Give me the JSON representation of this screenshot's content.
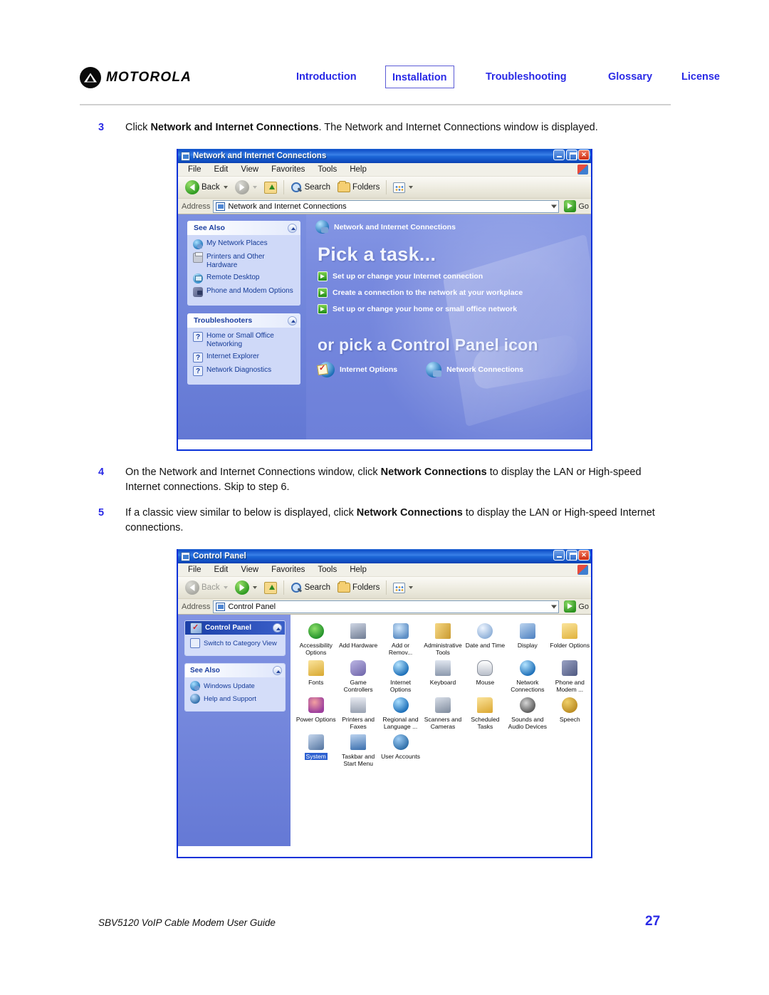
{
  "header": {
    "brand": "MOTOROLA",
    "brand_icon": "motorola-m-logo",
    "tabs": [
      {
        "label": "Introduction",
        "active": false
      },
      {
        "label": "Installation",
        "active": true
      },
      {
        "label": "Troubleshooting",
        "active": false
      },
      {
        "label": "Glossary",
        "active": false
      },
      {
        "label": "License",
        "active": false
      }
    ],
    "link_color": "#2a2ae6"
  },
  "steps": {
    "step3": {
      "number": "3",
      "pre": "Click ",
      "bold": "Network and Internet Connections",
      "post": ". The Network and Internet Connections window is displayed."
    },
    "step4": {
      "number": "4",
      "pre": "On the Network and Internet Connections window, click ",
      "bold": "Network Connections",
      "post": " to display the LAN or High-speed Internet connections. Skip to step 6."
    },
    "step5": {
      "number": "5",
      "pre": "If a classic view similar to below is displayed, click ",
      "bold": "Network Connections",
      "post": " to display the LAN or High-speed Internet connections."
    }
  },
  "window1": {
    "title": "Network and Internet Connections",
    "menus": [
      "File",
      "Edit",
      "View",
      "Favorites",
      "Tools",
      "Help"
    ],
    "toolbar": {
      "back": "Back",
      "search": "Search",
      "folders": "Folders"
    },
    "address": {
      "label": "Address",
      "value": "Network and Internet Connections",
      "go": "Go"
    },
    "breadcrumb": "Network and Internet Connections",
    "heading1": "Pick a task...",
    "heading2": "or pick a Control Panel icon",
    "tasks": [
      "Set up or change your Internet connection",
      "Create a connection to the network at your workplace",
      "Set up or change your home or small office network"
    ],
    "control_panel_icons": [
      "Internet Options",
      "Network Connections"
    ],
    "panels": [
      {
        "title": "See Also",
        "items": [
          {
            "label": "My Network Places",
            "icon": "globe-icon"
          },
          {
            "label": "Printers and Other Hardware",
            "icon": "printer-icon"
          },
          {
            "label": "Remote Desktop",
            "icon": "remote-desktop-icon"
          },
          {
            "label": "Phone and Modem Options",
            "icon": "phone-modem-icon"
          }
        ]
      },
      {
        "title": "Troubleshooters",
        "items": [
          {
            "label": "Home or Small Office Networking",
            "icon": "question-icon"
          },
          {
            "label": "Internet Explorer",
            "icon": "question-icon"
          },
          {
            "label": "Network Diagnostics",
            "icon": "question-icon"
          }
        ]
      }
    ]
  },
  "window2": {
    "title": "Control Panel",
    "menus": [
      "File",
      "Edit",
      "View",
      "Favorites",
      "Tools",
      "Help"
    ],
    "toolbar": {
      "back": "Back",
      "search": "Search",
      "folders": "Folders"
    },
    "address": {
      "label": "Address",
      "value": "Control Panel",
      "go": "Go"
    },
    "panels": [
      {
        "title": "Control Panel",
        "style": "dark",
        "items": [
          {
            "label": "Switch to Category View",
            "icon": "switch-view-icon"
          }
        ]
      },
      {
        "title": "See Also",
        "style": "light",
        "items": [
          {
            "label": "Windows Update",
            "icon": "windows-update-icon"
          },
          {
            "label": "Help and Support",
            "icon": "help-support-icon"
          }
        ]
      }
    ],
    "icons": [
      {
        "label": "Accessibility\nOptions",
        "glyph": "gh-access",
        "selected": false
      },
      {
        "label": "Add Hardware",
        "glyph": "gh-addhw",
        "selected": false
      },
      {
        "label": "Add or\nRemov...",
        "glyph": "gh-addrm",
        "selected": false
      },
      {
        "label": "Administrative\nTools",
        "glyph": "gh-admin",
        "selected": false
      },
      {
        "label": "Date and Time",
        "glyph": "gh-date",
        "selected": false
      },
      {
        "label": "Display",
        "glyph": "gh-disp",
        "selected": false
      },
      {
        "label": "Folder Options",
        "glyph": "gh-fold",
        "selected": false
      },
      {
        "label": "Fonts",
        "glyph": "gh-fonts",
        "selected": false
      },
      {
        "label": "Game\nControllers",
        "glyph": "gh-game",
        "selected": false
      },
      {
        "label": "Internet\nOptions",
        "glyph": "gh-inet",
        "selected": false
      },
      {
        "label": "Keyboard",
        "glyph": "gh-keyb",
        "selected": false
      },
      {
        "label": "Mouse",
        "glyph": "gh-mouse",
        "selected": false
      },
      {
        "label": "Network\nConnections",
        "glyph": "gh-netc",
        "selected": false
      },
      {
        "label": "Phone and\nModem ...",
        "glyph": "gh-phone",
        "selected": false
      },
      {
        "label": "Power Options",
        "glyph": "gh-power",
        "selected": false
      },
      {
        "label": "Printers and\nFaxes",
        "glyph": "gh-print",
        "selected": false
      },
      {
        "label": "Regional and\nLanguage ...",
        "glyph": "gh-region",
        "selected": false
      },
      {
        "label": "Scanners and\nCameras",
        "glyph": "gh-scan",
        "selected": false
      },
      {
        "label": "Scheduled\nTasks",
        "glyph": "gh-sched",
        "selected": false
      },
      {
        "label": "Sounds and\nAudio Devices",
        "glyph": "gh-sound",
        "selected": false
      },
      {
        "label": "Speech",
        "glyph": "gh-speech",
        "selected": false
      },
      {
        "label": "System",
        "glyph": "gh-system",
        "selected": true
      },
      {
        "label": "Taskbar and\nStart Menu",
        "glyph": "gh-taskb",
        "selected": false
      },
      {
        "label": "User Accounts",
        "glyph": "gh-user",
        "selected": false
      }
    ]
  },
  "footer": {
    "doc_title": "SBV5120 VoIP Cable Modem User Guide",
    "page_number": "27"
  }
}
